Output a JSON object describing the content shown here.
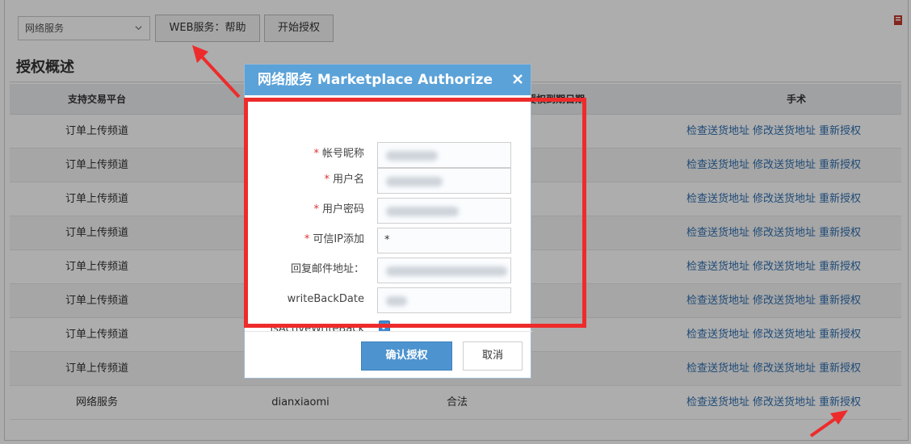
{
  "toolbar": {
    "select_value": "网络服务",
    "web_help_label": "WEB服务：帮助",
    "start_auth_label": "开始授权"
  },
  "section_title": "授权概述",
  "table": {
    "headers": {
      "platform": "支持交易平台",
      "partial": "授权到期日期",
      "operations": "手术"
    },
    "rows": [
      {
        "platform": "订单上传频道",
        "account": "",
        "status": "",
        "ops": [
          "检查送货地址",
          "修改送货地址",
          "重新授权"
        ]
      },
      {
        "platform": "订单上传频道",
        "account": "",
        "status": "",
        "ops": [
          "检查送货地址",
          "修改送货地址",
          "重新授权"
        ]
      },
      {
        "platform": "订单上传频道",
        "account": "",
        "status": "",
        "ops": [
          "检查送货地址",
          "修改送货地址",
          "重新授权"
        ]
      },
      {
        "platform": "订单上传频道",
        "account": "",
        "status": "",
        "ops": [
          "检查送货地址",
          "修改送货地址",
          "重新授权"
        ]
      },
      {
        "platform": "订单上传频道",
        "account": "",
        "status": "",
        "ops": [
          "检查送货地址",
          "修改送货地址",
          "重新授权"
        ]
      },
      {
        "platform": "订单上传频道",
        "account": "",
        "status": "",
        "ops": [
          "检查送货地址",
          "修改送货地址",
          "重新授权"
        ]
      },
      {
        "platform": "订单上传频道",
        "account": "",
        "status": "",
        "ops": [
          "检查送货地址",
          "修改送货地址",
          "重新授权"
        ]
      },
      {
        "platform": "订单上传频道",
        "account": "",
        "status": "",
        "ops": [
          "检查送货地址",
          "修改送货地址",
          "重新授权"
        ]
      },
      {
        "platform": "网络服务",
        "account": "dianxiaomi",
        "status": "合法",
        "ops": [
          "检查送货地址",
          "修改送货地址",
          "重新授权"
        ]
      }
    ]
  },
  "dialog": {
    "title": "网络服务 Marketplace Authorize",
    "fields": [
      {
        "label": "帐号昵称",
        "required": true,
        "value": ""
      },
      {
        "label": "用户名",
        "required": true,
        "value": ""
      },
      {
        "label": "用户密码",
        "required": true,
        "value": ""
      },
      {
        "label": "可信IP添加",
        "required": true,
        "value": "*"
      },
      {
        "label": "回复邮件地址：",
        "required": false,
        "value": ""
      },
      {
        "label": "writeBackDate",
        "required": false,
        "value": ""
      }
    ],
    "checkbox": {
      "label": "isActiveWriteBack",
      "checked": true
    },
    "confirm_label": "确认授权",
    "cancel_label": "取消"
  },
  "colors": {
    "dialog_header": "#5ba2d8",
    "link": "#2f6fb0",
    "annotation": "#ee2b2b"
  }
}
